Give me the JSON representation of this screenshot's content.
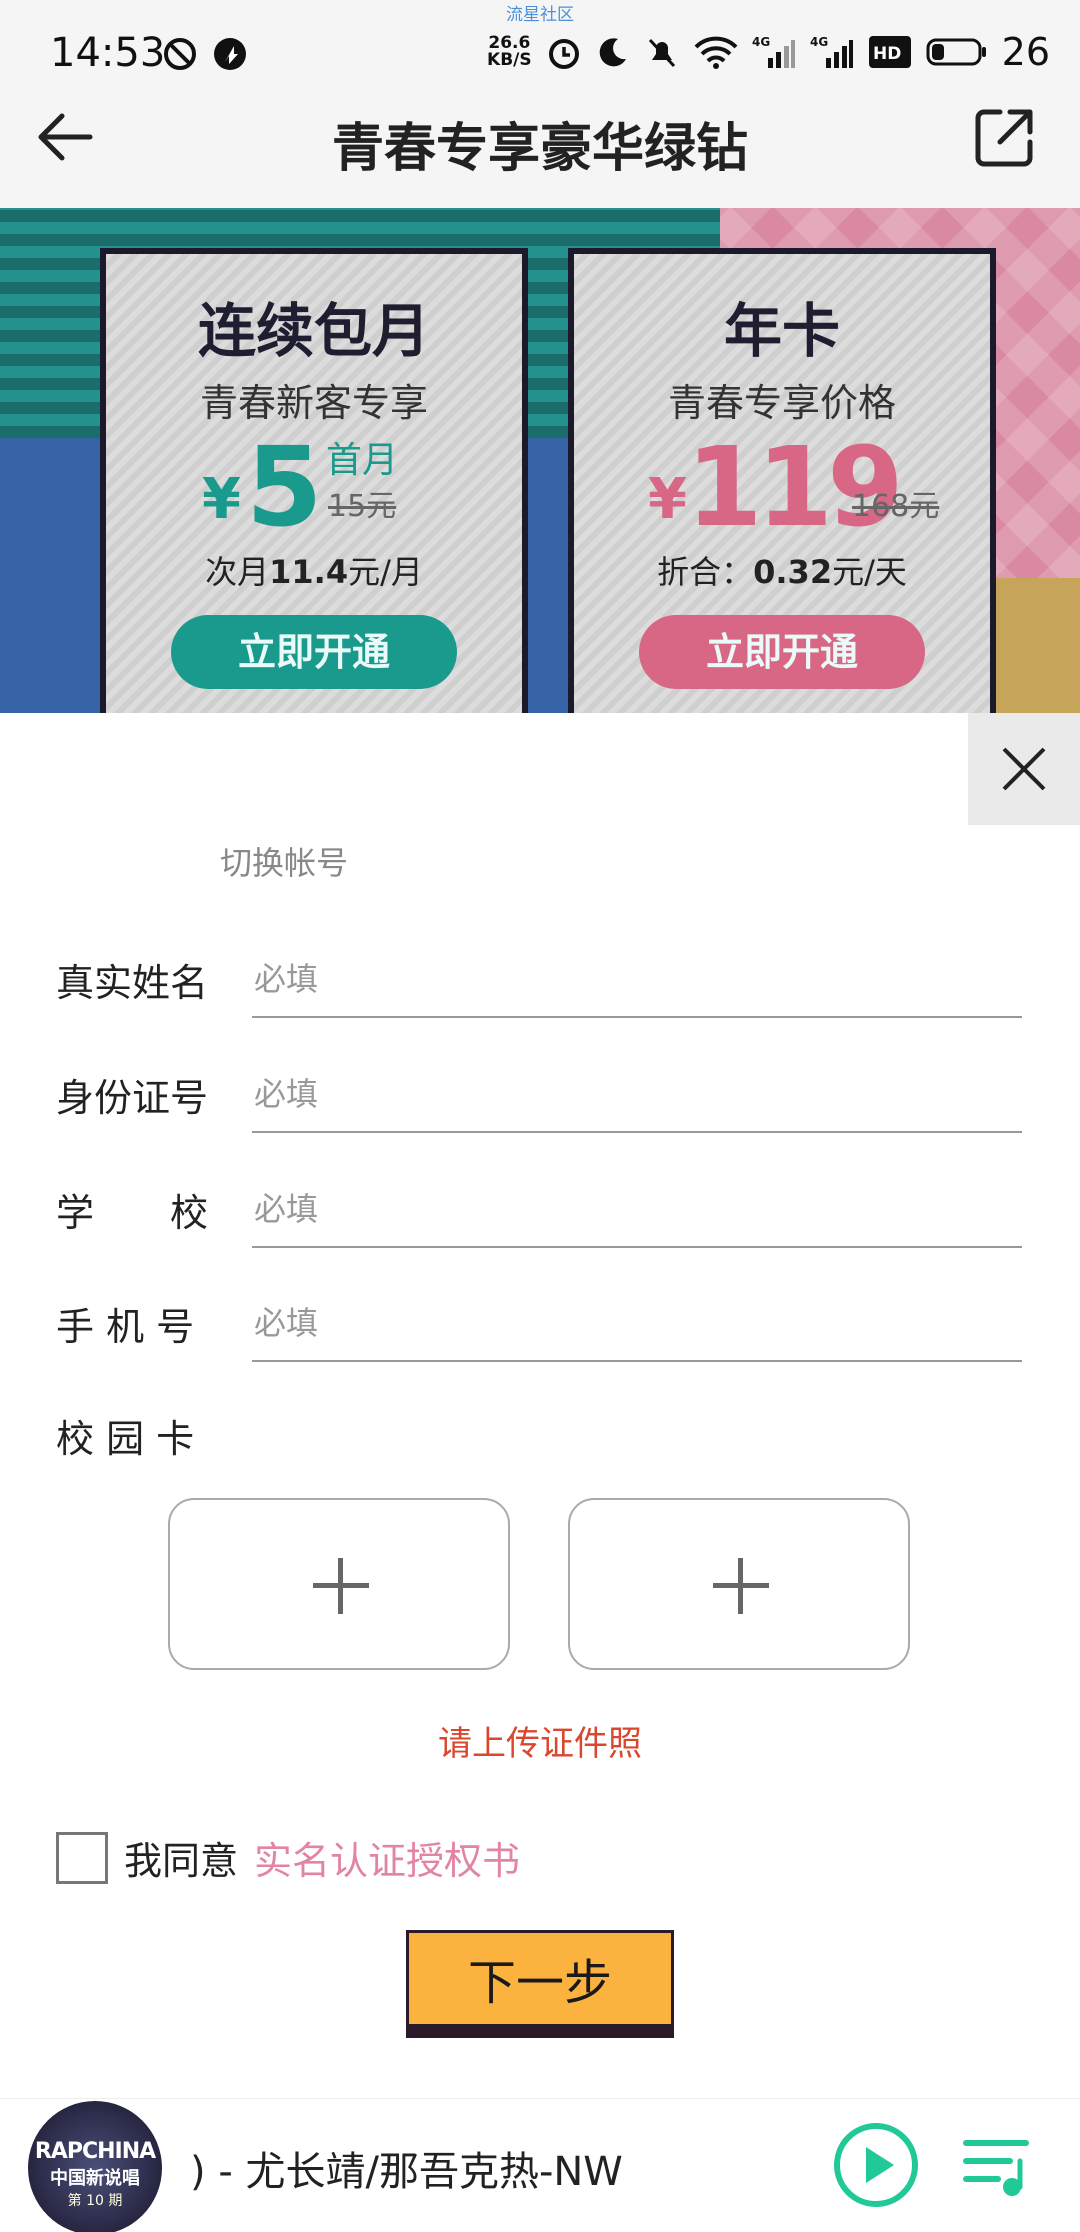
{
  "status": {
    "watermark": "流星社区",
    "time": "14:53",
    "net_speed_top": "26.6",
    "net_speed_bottom": "KB/S",
    "battery": "26",
    "icons": [
      "do-not-disturb-icon",
      "app-notification-icon",
      "alarm-icon",
      "moon-icon",
      "mute-icon",
      "wifi-icon",
      "signal-4g-icon",
      "signal-4g-icon",
      "hd-icon",
      "battery-icon"
    ]
  },
  "header": {
    "title": "青春专享豪华绿钻"
  },
  "banner": {
    "left_card": {
      "title": "连续包月",
      "subtitle": "青春新客专享",
      "currency": "¥",
      "price": "5",
      "price_tag": "首月",
      "original_price": "15元",
      "note_prefix": "次月",
      "note_value": "11.4",
      "note_suffix": "元/月",
      "button": "立即开通"
    },
    "right_card": {
      "title": "年卡",
      "subtitle": "青春专享价格",
      "currency": "¥",
      "price": "119",
      "original_price": "168元",
      "note_prefix": "折合：",
      "note_value": "0.32",
      "note_suffix": "元/天",
      "button": "立即开通"
    }
  },
  "form": {
    "switch_account": "切换帐号",
    "fields": [
      {
        "label": "真实姓名",
        "placeholder": "必填"
      },
      {
        "label": "身份证号",
        "placeholder": "必填"
      },
      {
        "label": "学　　校",
        "placeholder": "必填"
      },
      {
        "label": "手 机 号",
        "placeholder": "必填"
      }
    ],
    "campus_card_label": "校 园 卡",
    "upload_hint": "请上传证件照",
    "agree_text": "我同意",
    "agree_link": "实名认证授权书",
    "next_button": "下一步"
  },
  "player": {
    "album_line1": "RAPCHINA",
    "album_line2": "中国新说唱",
    "album_line3": "第 10 期",
    "track": ") - 尤长靖/那吾克热-NW"
  },
  "colors": {
    "accent_teal": "#1a9a8c",
    "accent_pink": "#d76784",
    "link_pink": "#e284a6",
    "warning_red": "#d9482e",
    "next_button": "#fcb23f",
    "play_green": "#20c997"
  }
}
